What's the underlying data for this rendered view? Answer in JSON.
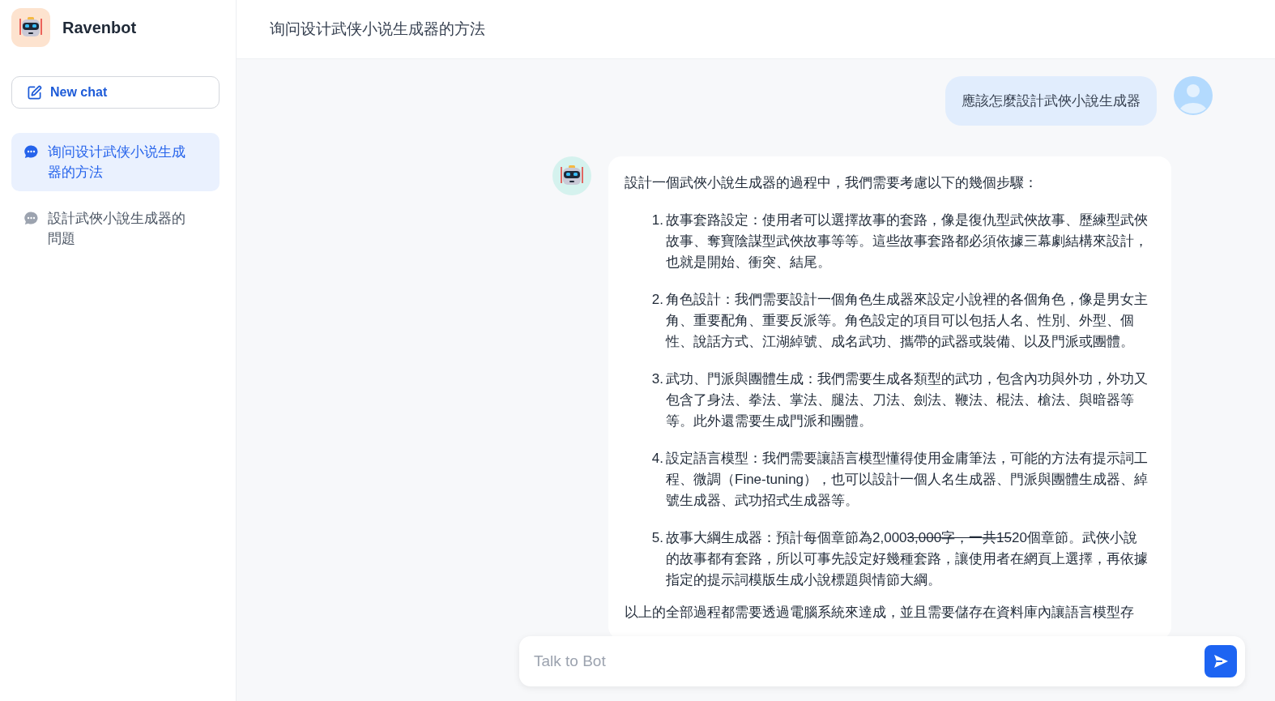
{
  "app": {
    "name": "Ravenbot"
  },
  "sidebar": {
    "new_chat": "New chat",
    "chats": [
      {
        "title": "询问设计武侠小说生成器的方法",
        "selected": true
      },
      {
        "title": "設計武俠小說生成器的問題",
        "selected": false
      }
    ]
  },
  "header": {
    "title": "询问设计武侠小说生成器的方法"
  },
  "messages": [
    {
      "kind": "user",
      "text": "應該怎麼設計武俠小說生成器"
    },
    {
      "kind": "bot",
      "intro": "設計一個武俠小說生成器的過程中，我們需要考慮以下的幾個步驟：",
      "steps": [
        {
          "number": "1.",
          "segments": [
            {
              "text": "故事套路設定：使用者可以選擇故事的套路，像是復仇型武俠故事、歷練型武俠故事、奪寶陰謀型武俠故事等等。這些故事套路都必須依據三幕劇結構來設計，也就是開始、衝突、結尾。",
              "strike": false
            }
          ]
        },
        {
          "number": "2.",
          "segments": [
            {
              "text": "角色設計：我們需要設計一個角色生成器來設定小說裡的各個角色，像是男女主角、重要配角、重要反派等。角色設定的項目可以包括人名、性別、外型、個性、說話方式、江湖綽號、成名武功、攜帶的武器或裝備、以及門派或團體。",
              "strike": false
            }
          ]
        },
        {
          "number": "3.",
          "segments": [
            {
              "text": "武功、門派與團體生成：我們需要生成各類型的武功，包含內功與外功，外功又包含了身法、拳法、掌法、腿法、刀法、劍法、鞭法、棍法、槍法、與暗器等等。此外還需要生成門派和團體。",
              "strike": false
            }
          ]
        },
        {
          "number": "4.",
          "segments": [
            {
              "text": "設定語言模型：我們需要讓語言模型懂得使用金庸筆法，可能的方法有提示詞工程、微調（Fine-tuning），也可以設計一個人名生成器、門派與團體生成器、綽號生成器、武功招式生成器等。",
              "strike": false
            }
          ]
        },
        {
          "number": "5.",
          "segments": [
            {
              "text": "故事大綱生成器：預計每個章節為2,000",
              "strike": false
            },
            {
              "text": "3,000字，一共15",
              "strike": true
            },
            {
              "text": "20個章節。武俠小說的故事都有套路，所以可事先設定好幾種套路，讓使用者在網頁上選擇，再依據指定的提示詞模版生成小說標題與情節大綱。",
              "strike": false
            }
          ]
        }
      ],
      "outro": "以上的全部過程都需要透過電腦系統來達成，並且需要儲存在資料庫內讓語言模型存"
    }
  ],
  "composer": {
    "placeholder": "Talk to Bot"
  }
}
